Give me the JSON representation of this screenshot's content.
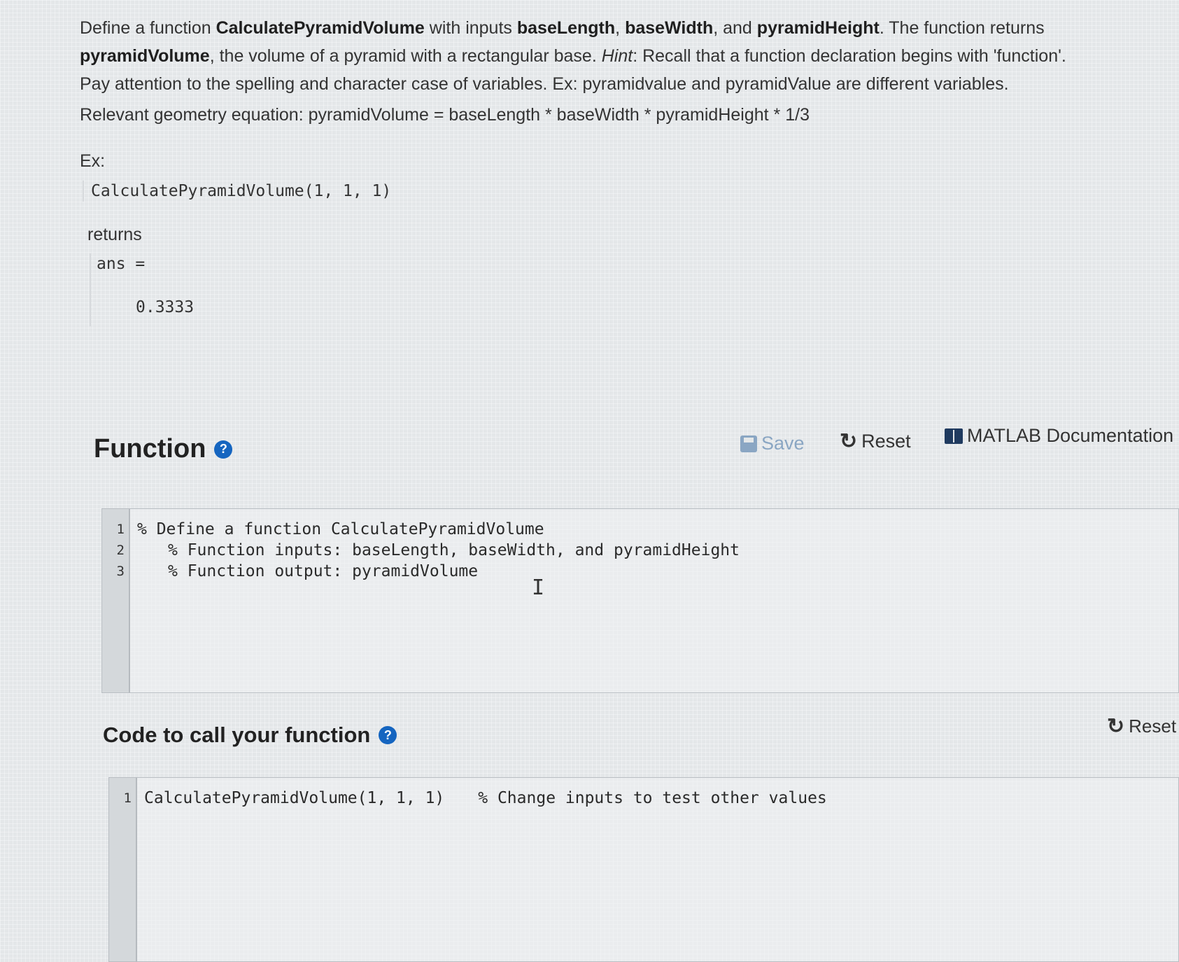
{
  "problem": {
    "p1_a": "Define a function ",
    "p1_fn": "CalculatePyramidVolume",
    "p1_b": " with inputs ",
    "p1_in1": "baseLength",
    "p1_c": ", ",
    "p1_in2": "baseWidth",
    "p1_d": ", and ",
    "p1_in3": "pyramidHeight",
    "p1_e": ". The function returns ",
    "p1_out": "pyramidVolume",
    "p1_f": ", the volume of a pyramid with a rectangular base. ",
    "p1_hint": "Hint",
    "p1_g": ": Recall that a function declaration begins with 'function'. Pay attention to the spelling and character case of variables. Ex: pyramidvalue and pyramidValue are different variables."
  },
  "equation": "Relevant geometry equation: pyramidVolume = baseLength * baseWidth * pyramidHeight * 1/3",
  "ex_label": "Ex:",
  "example_call": "CalculatePyramidVolume(1, 1, 1)",
  "returns_label": "returns",
  "example_output": {
    "line1": "ans =",
    "line2": "0.3333"
  },
  "function_section": {
    "title": "Function",
    "help": "?",
    "save_label": "Save",
    "reset_label": "Reset",
    "doc_label": "MATLAB Documentation",
    "line_numbers": [
      "1",
      "2",
      "3"
    ],
    "code": [
      "% Define a function CalculatePyramidVolume",
      "% Function inputs: baseLength, baseWidth, and pyramidHeight",
      "% Function output: pyramidVolume"
    ]
  },
  "call_section": {
    "title": "Code to call your function",
    "help": "?",
    "reset_label": "Reset",
    "line_numbers": [
      "1"
    ],
    "code_call": "CalculatePyramidVolume(1, 1, 1)",
    "code_comment": "% Change inputs to test other values"
  },
  "icons": {
    "help": "question-circle-icon",
    "save": "floppy-disk-icon",
    "reset": "circular-arrow-icon",
    "doc": "book-icon"
  },
  "colors": {
    "help_blue": "#1565c0",
    "save_disabled": "#8aa6c3"
  }
}
